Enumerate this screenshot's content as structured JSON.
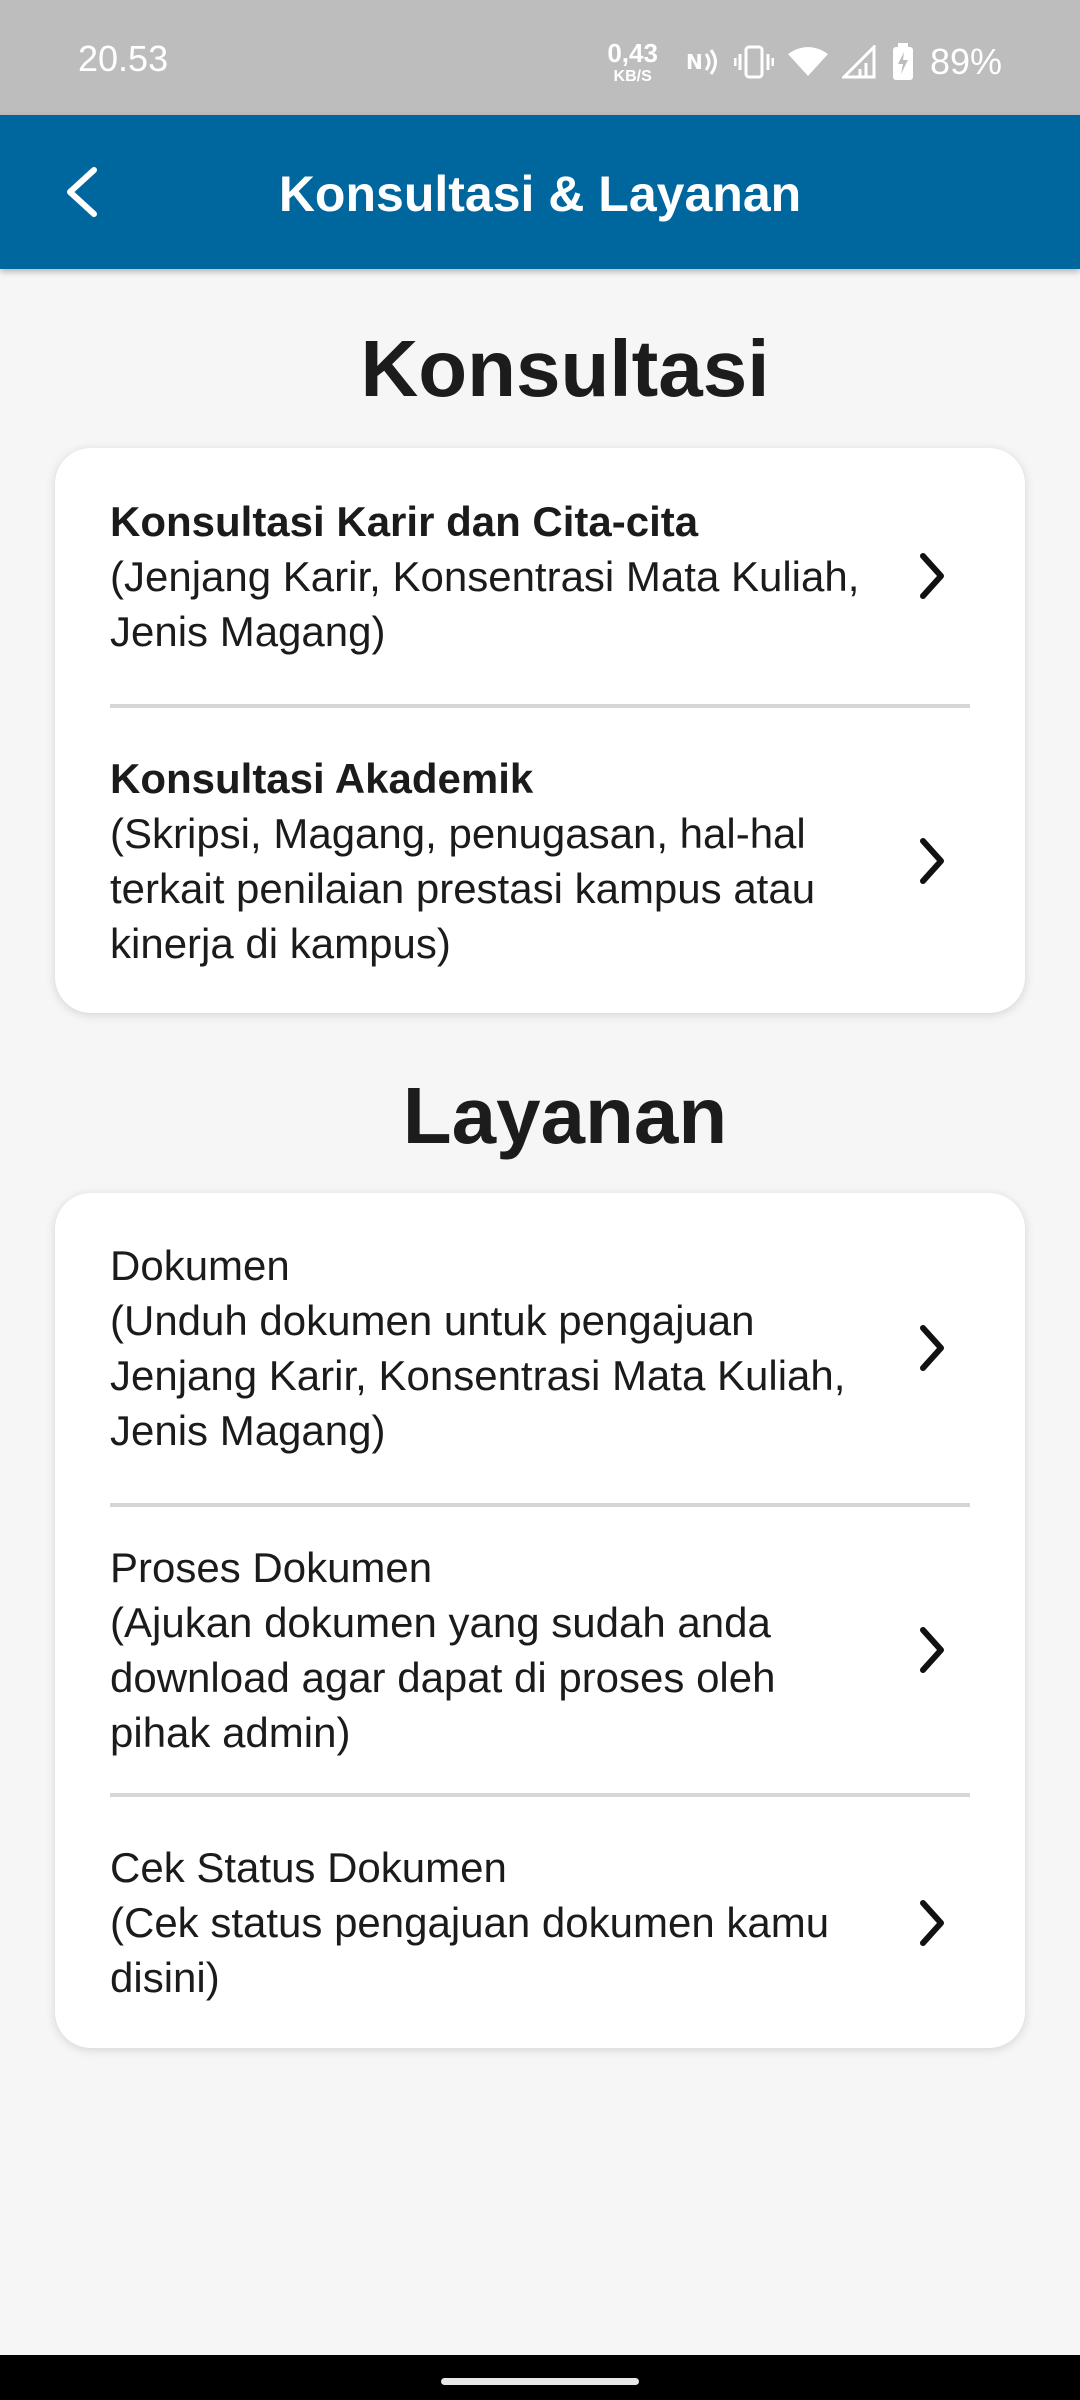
{
  "status_bar": {
    "time": "20.53",
    "net_speed": "0,43",
    "net_unit": "KB/S",
    "battery": "89%"
  },
  "app_bar": {
    "title": "Konsultasi & Layanan",
    "back_icon": "arrow-back-icon"
  },
  "konsultasi": {
    "title": "Konsultasi",
    "items": [
      {
        "title": "Konsultasi Karir dan Cita-cita",
        "desc": "(Jenjang Karir, Konsentrasi Mata Kuliah, Jenis Magang)"
      },
      {
        "title": "Konsultasi Akademik",
        "desc": "(Skripsi, Magang, penugasan, hal-hal terkait penilaian prestasi kampus atau kinerja di kampus)"
      }
    ]
  },
  "layanan": {
    "title": "Layanan",
    "items": [
      {
        "title": "Dokumen",
        "desc": "(Unduh dokumen untuk pengajuan Jenjang Karir, Konsentrasi Mata Kuliah, Jenis Magang)"
      },
      {
        "title": "Proses Dokumen",
        "desc": "(Ajukan dokumen yang sudah anda download agar dapat di proses oleh pihak admin)"
      },
      {
        "title": "Cek Status Dokumen",
        "desc": "(Cek status pengajuan dokumen kamu disini)"
      }
    ]
  },
  "colors": {
    "app_bar": "#00669e",
    "status_bar": "#bdbdbd",
    "background": "#f6f6f6"
  }
}
